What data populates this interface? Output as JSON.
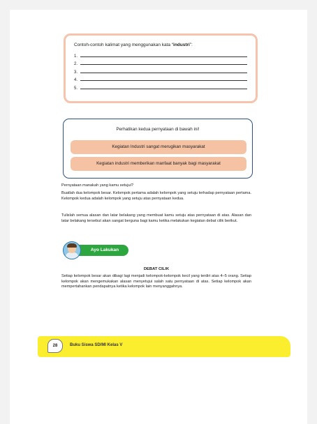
{
  "box1": {
    "title_prefix": "Contoh-contoh kalimat yang menggunakan kata “",
    "title_keyword": "industri",
    "title_suffix": "”:",
    "numbers": [
      "1.",
      "2.",
      "3.",
      "4.",
      "5."
    ]
  },
  "box2": {
    "title": "Perhatikan kedua pernyataan di bawah ini!",
    "statement1": "Kegiatan Industri sangat merugikan masyarakat",
    "statement2": "Kegiatan industri memberikan manfaat banyak bagi masyarakat"
  },
  "paragraphs": {
    "question": "Pernyataan manakah yang kamu setujui?",
    "p1": "Buatlah dua kelompok besar. Kelompok pertama adalah kelompok yang setuju terhadap pernyataan pertama. Kelompok kedua adalah kelompok yang setuju atas pernyataan kedua.",
    "p2": "Tulislah semua alasan dan latar belakang yang membuat kamu setuju atas pernyataan di atas. Alasan dan latar belakang tersebut akan sangat berguna bagi kamu ketika melakukan kegiatan debat cilik berikut."
  },
  "ayo": {
    "label": "Ayo Lakukan"
  },
  "debat": {
    "title": "DEBAT CILIK",
    "text": "Setiap kelompok besar akan dibagi lagi menjadi kelompok-kelompok kecil yang terdiri atas 4–5 orang. Setiap kelompok akan mengemukakan alasan menyetujui salah satu pernyataan di atas. Setiap kelompok akan mempertahankan pendapatnya ketika kelompok lain menyanggahnya."
  },
  "footer": {
    "page_number": "28",
    "book_title": "Buku Siswa SD/MI Kelas V"
  },
  "colors": {
    "box1_border": "#f6c3ad",
    "pill_fill": "#f6c2a4",
    "box2_border": "#2f4f80",
    "ayo_green": "#2da640",
    "footer_yellow": "#fbee2e"
  }
}
